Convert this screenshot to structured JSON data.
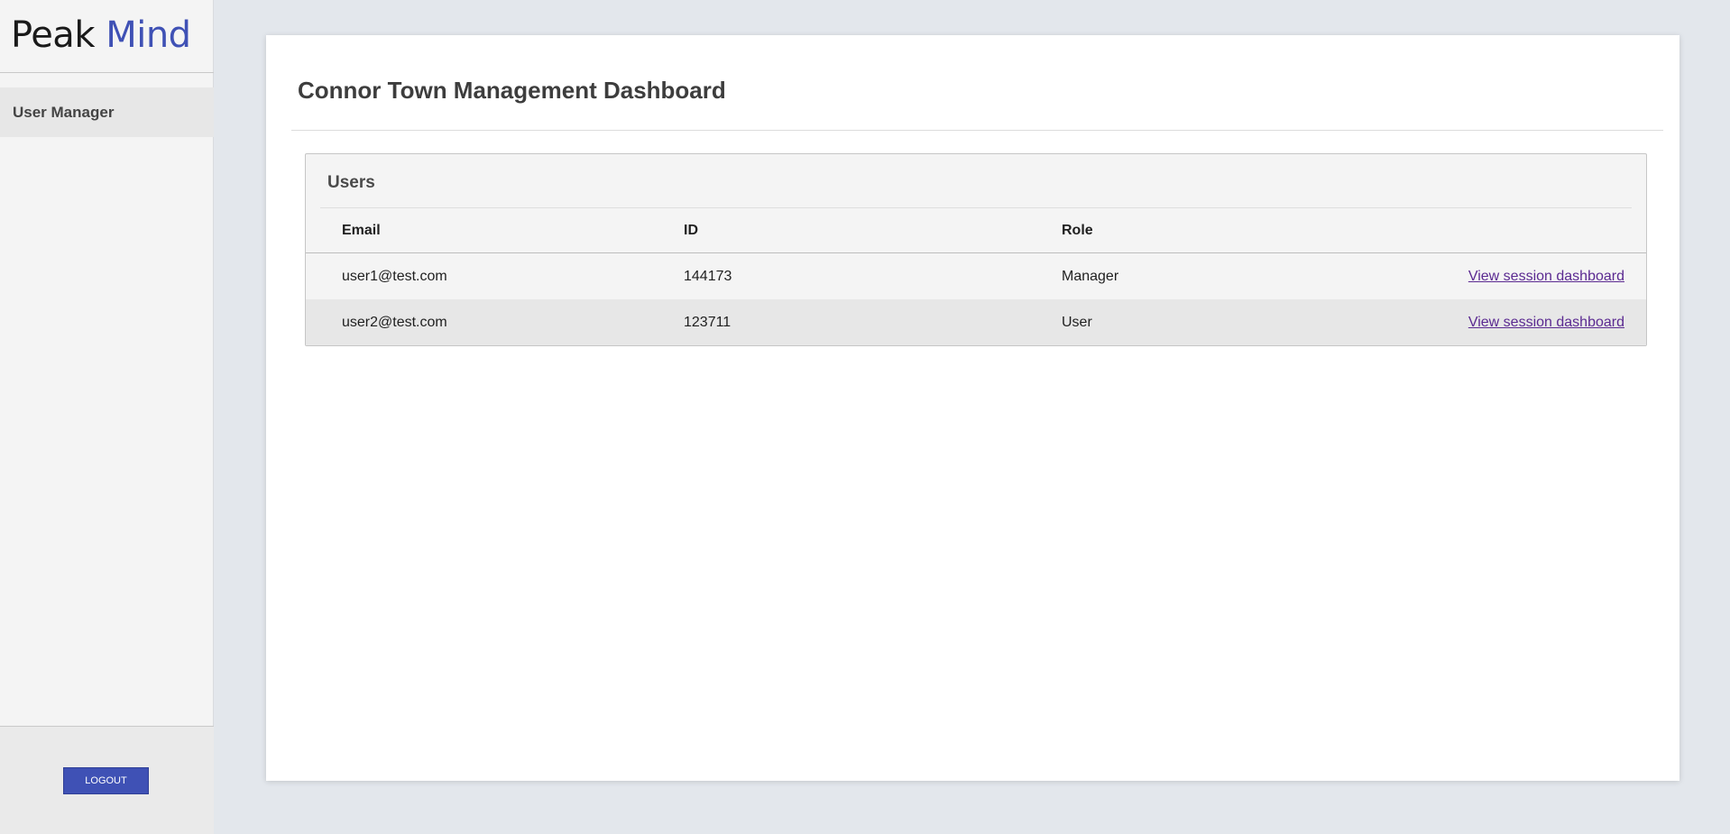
{
  "brand": {
    "name_part1": "Peak",
    "name_part2": "Mind",
    "accent_color": "#3f51b5"
  },
  "sidebar": {
    "items": [
      {
        "label": "User Manager"
      }
    ],
    "logout_label": "LOGOUT"
  },
  "main": {
    "title": "Connor Town Management Dashboard",
    "panel": {
      "title": "Users",
      "columns": [
        "Email",
        "ID",
        "Role"
      ],
      "rows": [
        {
          "email": "user1@test.com",
          "id": "144173",
          "role": "Manager",
          "action": "View session dashboard"
        },
        {
          "email": "user2@test.com",
          "id": "123711",
          "role": "User",
          "action": "View session dashboard"
        }
      ]
    }
  }
}
